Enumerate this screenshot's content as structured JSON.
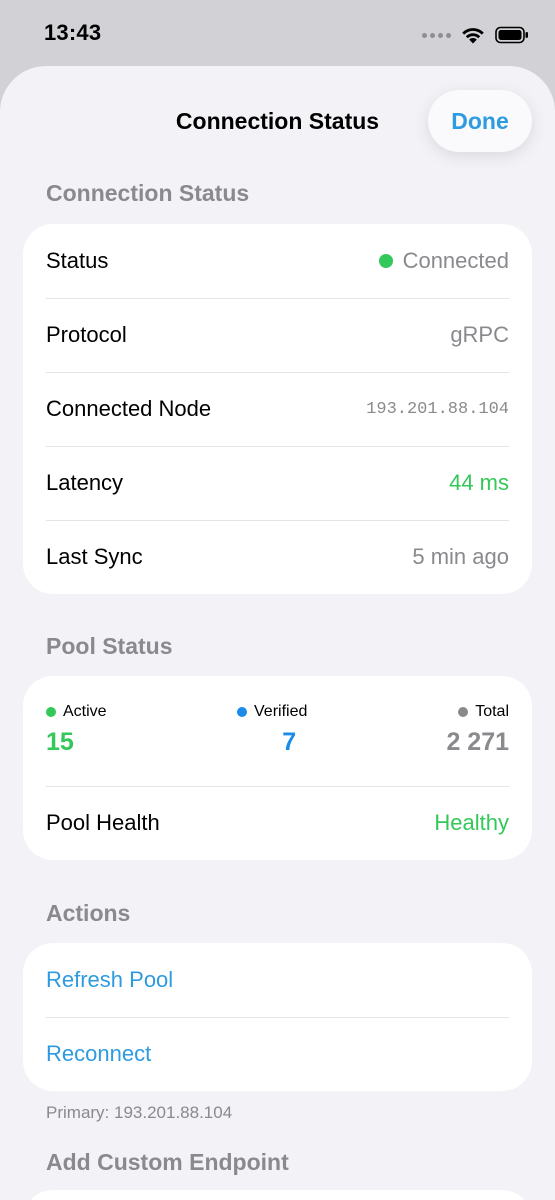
{
  "status_bar": {
    "time": "13:43",
    "icons": [
      "signal-dots-icon",
      "wifi-icon",
      "battery-icon"
    ]
  },
  "nav": {
    "title": "Connection Status",
    "done_label": "Done"
  },
  "connection_section": {
    "header": "Connection Status",
    "rows": [
      {
        "label": "Status",
        "value": "Connected"
      },
      {
        "label": "Protocol",
        "value": "gRPC"
      },
      {
        "label": "Connected Node",
        "value": "193.201.88.104"
      },
      {
        "label": "Latency",
        "value": "44 ms"
      },
      {
        "label": "Last Sync",
        "value": "5 min ago"
      }
    ]
  },
  "pool_section": {
    "header": "Pool Status",
    "stats": {
      "active": {
        "label": "Active",
        "value": "15"
      },
      "verified": {
        "label": "Verified",
        "value": "7"
      },
      "total": {
        "label": "Total",
        "value": "2 271"
      }
    },
    "health": {
      "label": "Pool Health",
      "value": "Healthy"
    }
  },
  "actions_section": {
    "header": "Actions",
    "refresh_label": "Refresh Pool",
    "reconnect_label": "Reconnect",
    "footer": "Primary: 193.201.88.104"
  },
  "custom_endpoint_section": {
    "header": "Add Custom Endpoint"
  },
  "colors": {
    "accent": "#2e9be0",
    "green": "#34c759",
    "verified_blue": "#1a8be6",
    "gray": "#8a8a8e",
    "background": "#f2f2f7"
  }
}
